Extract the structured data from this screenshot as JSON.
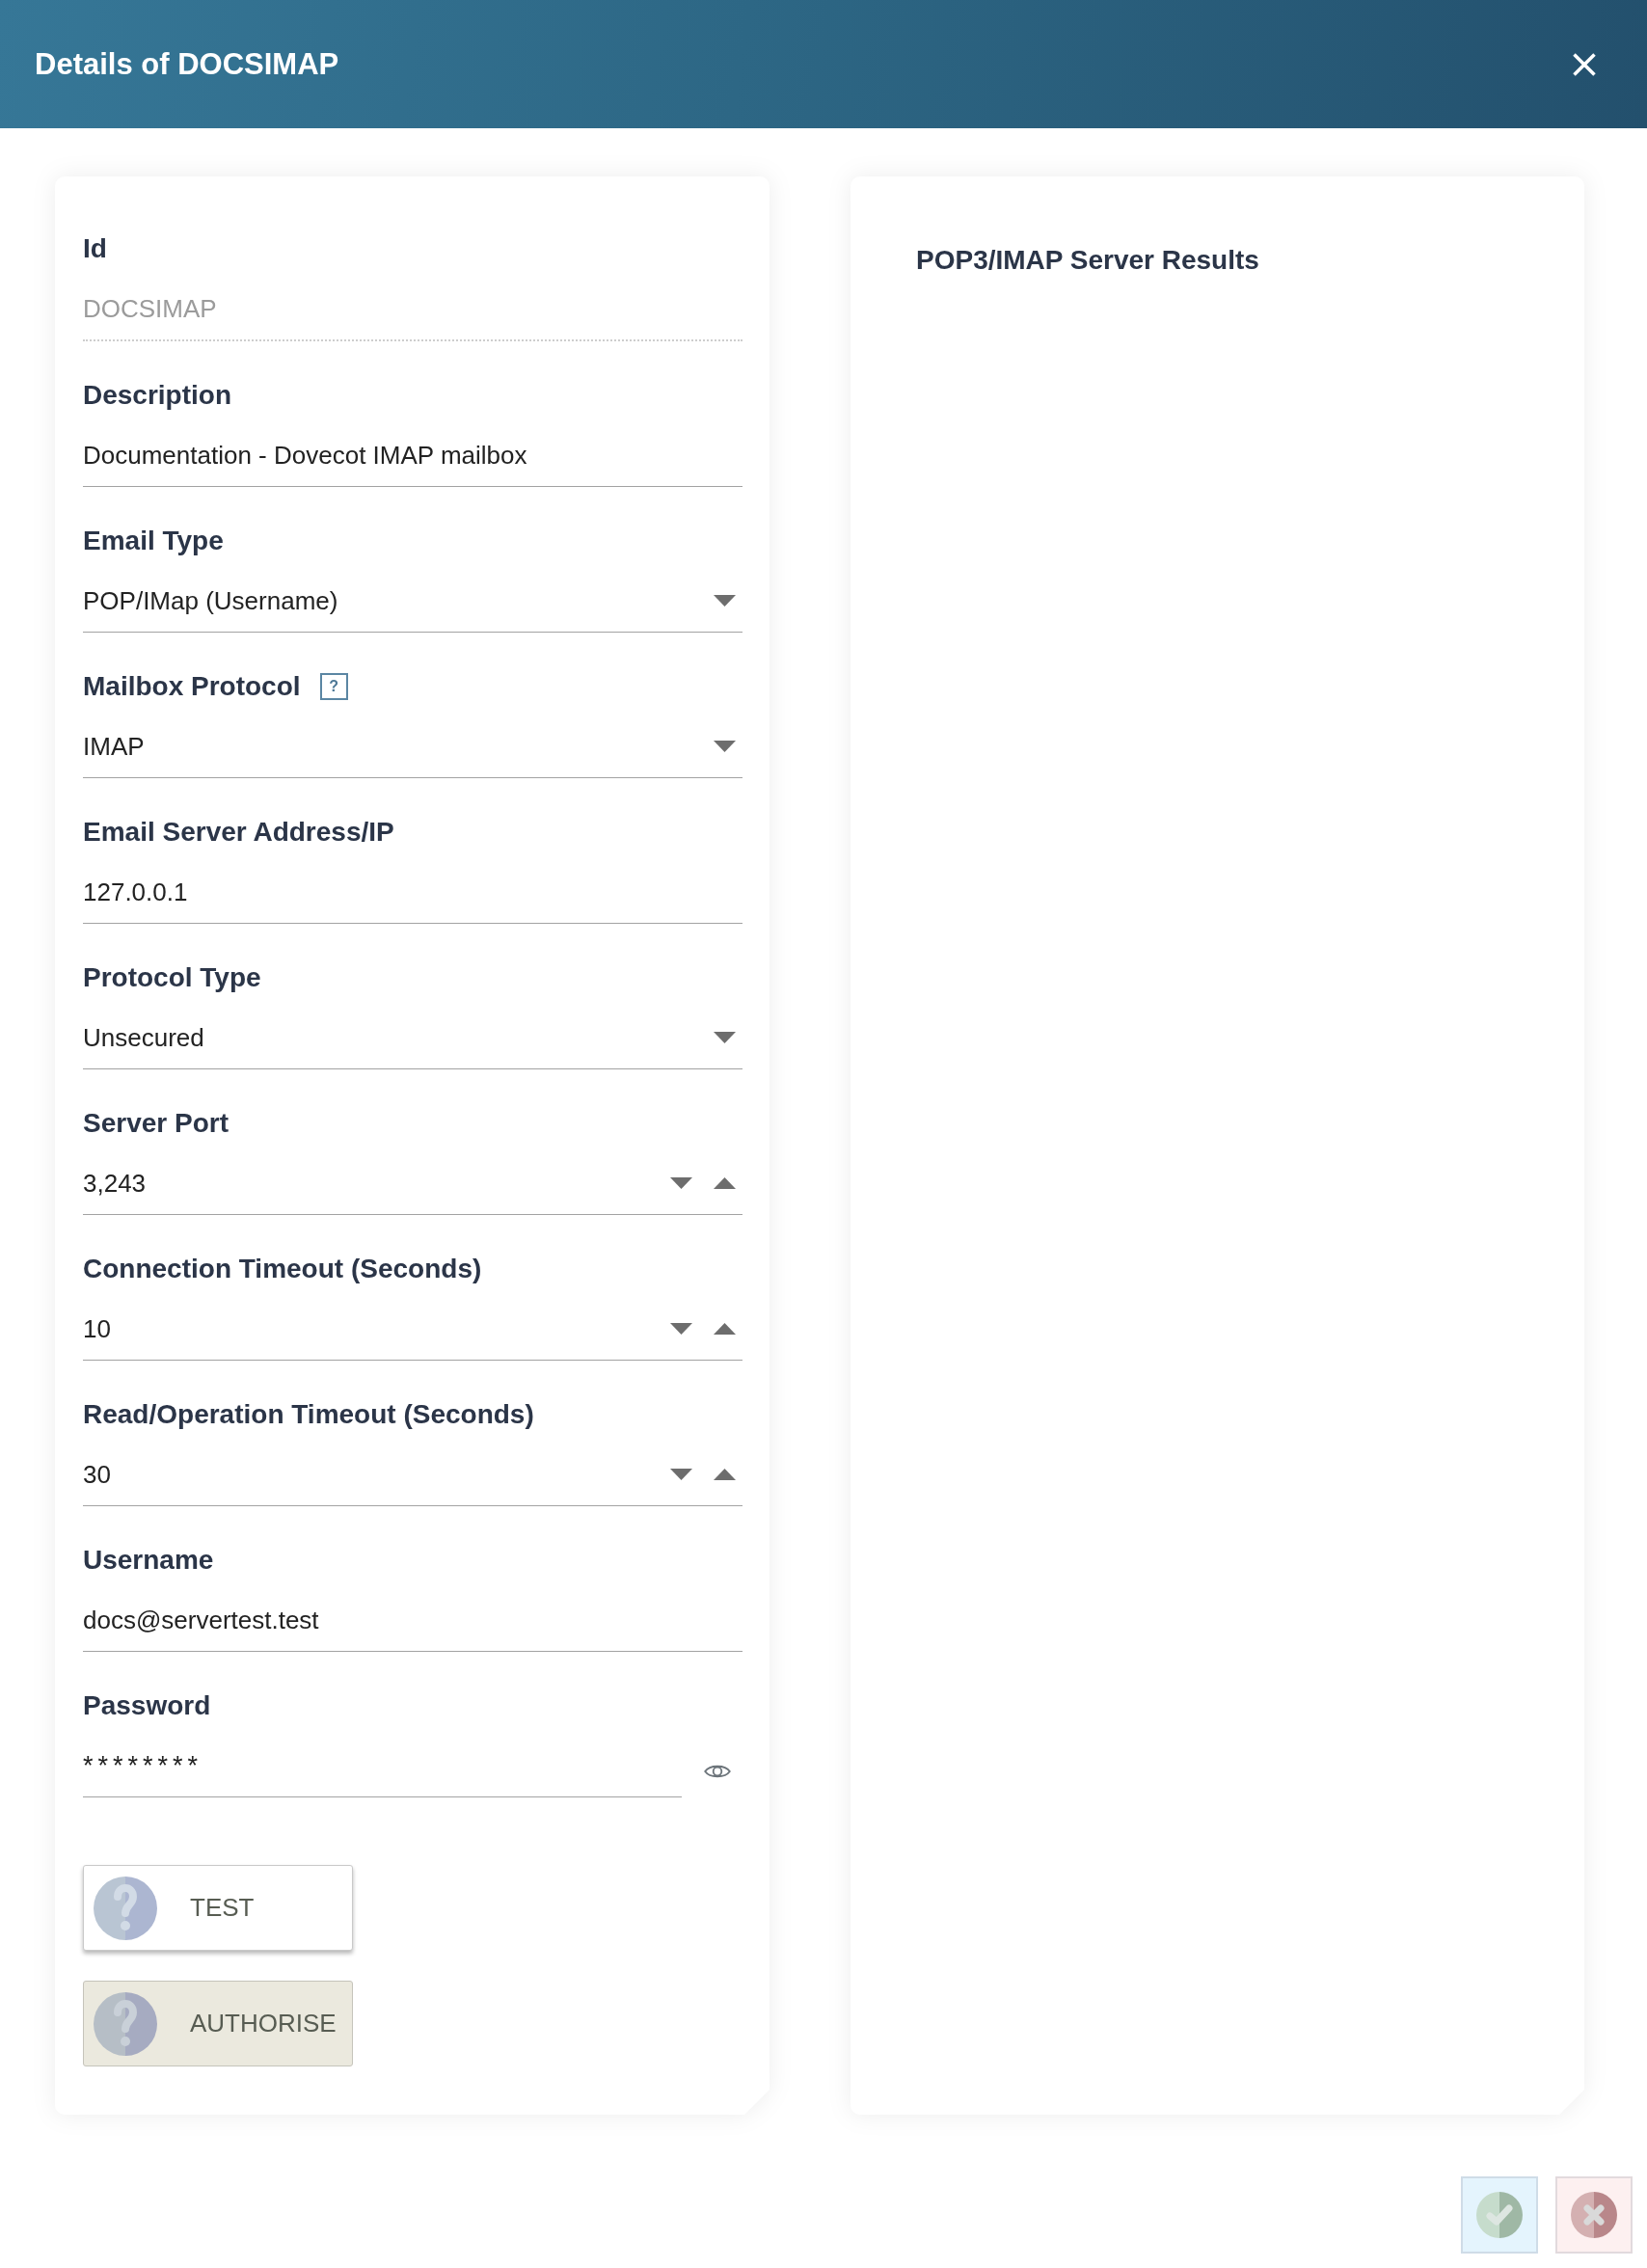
{
  "dialog": {
    "title": "Details of DOCSIMAP"
  },
  "form": {
    "fields": [
      {
        "label": "Id",
        "kind": "text",
        "value": "DOCSIMAP",
        "disabled": true
      },
      {
        "label": "Description",
        "kind": "text",
        "value": "Documentation - Dovecot IMAP mailbox",
        "disabled": false
      },
      {
        "label": "Email Type",
        "kind": "select",
        "value": "POP/IMap (Username)",
        "disabled": false
      },
      {
        "label": "Mailbox Protocol",
        "help": "?",
        "kind": "select",
        "value": "IMAP",
        "disabled": false
      },
      {
        "label": "Email Server Address/IP",
        "kind": "text",
        "value": "127.0.0.1",
        "disabled": false
      },
      {
        "label": "Protocol Type",
        "kind": "select",
        "value": "Unsecured",
        "disabled": false
      },
      {
        "label": "Server Port",
        "kind": "number",
        "value": "3,243",
        "disabled": false
      },
      {
        "label": "Connection Timeout (Seconds)",
        "kind": "number",
        "value": "10",
        "disabled": false
      },
      {
        "label": "Read/Operation Timeout (Seconds)",
        "kind": "number",
        "value": "30",
        "disabled": false
      },
      {
        "label": "Username",
        "kind": "text",
        "value": "docs@servertest.test",
        "disabled": false
      },
      {
        "label": "Password",
        "kind": "password",
        "value": "********",
        "disabled": false
      }
    ],
    "buttons": [
      {
        "label": "TEST",
        "disabled": false
      },
      {
        "label": "AUTHORISE",
        "disabled": true
      }
    ]
  },
  "results_panel": {
    "title": "POP3/IMAP Server Results"
  },
  "footer": {
    "buttons": [
      {
        "kind": "confirm"
      },
      {
        "kind": "cancel"
      }
    ]
  }
}
